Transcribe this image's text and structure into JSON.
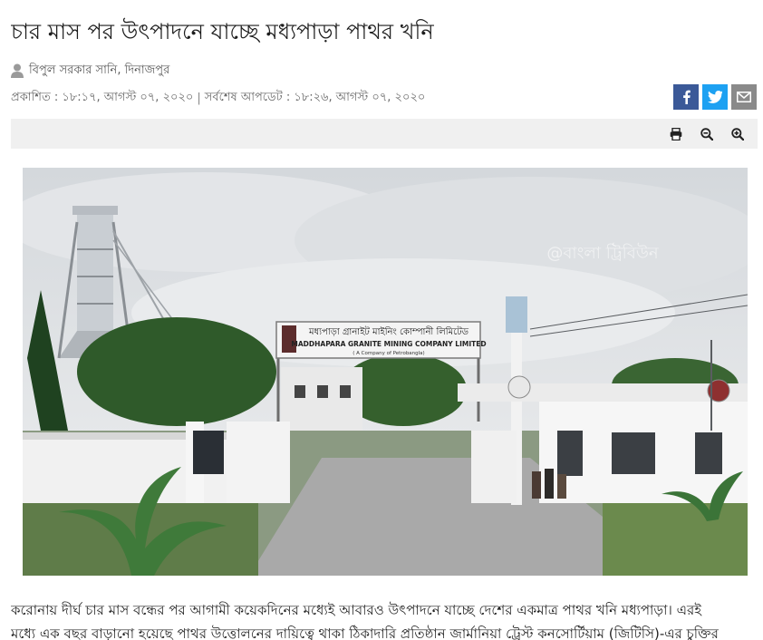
{
  "article": {
    "headline": "চার মাস পর উৎপাদনে যাচ্ছে মধ্যপাড়া পাথর খনি",
    "author": "বিপুল সরকার সানি, দিনাজপুর",
    "published": "প্রকাশিত : ১৮:১৭, আগস্ট ০৭, ২০২০",
    "separator": "|",
    "updated": "সর্বশেষ আপডেট : ১৮:২৬, আগস্ট ০৭, ২০২০",
    "body_line_1": "করোনায় দীর্ঘ চার মাস বন্ধের পর আগামী কয়েকদিনের মধ্যেই আবারও উৎপাদনে যাচ্ছে দেশের একমাত্র পাথর খনি মধ্যপাড়া। এরই",
    "body_line_2": "মধ্যে এক বছর বাড়ানো হয়েছে পাথর উত্তোলনের দায়িত্বে থাকা ঠিকাদারি প্রতিষ্ঠান জার্মানিয়া ট্রেস্ট কনসোর্টিয়াম (জিটিসি)-এর চুক্তির"
  },
  "photo": {
    "sign_line_1": "মধ্যপাড়া গ্রানাইট মাইনিং কোম্পানী লিমিটেড",
    "sign_line_2": "MADDHAPARA GRANITE MINING COMPANY LIMITED",
    "sign_line_3": "( A Company of Petrobangla)",
    "watermark": "@বাংলা ট্রিবিউন"
  },
  "share": {
    "icons": [
      "facebook-icon",
      "twitter-icon",
      "email-icon"
    ]
  },
  "toolbar": {
    "icons": [
      "print-icon",
      "zoom-out-icon",
      "zoom-in-icon"
    ]
  },
  "colors": {
    "facebook": "#3b5998",
    "twitter": "#1da1f2",
    "email": "#8a8a8a",
    "toolbar_bg": "#f0f0f0"
  }
}
